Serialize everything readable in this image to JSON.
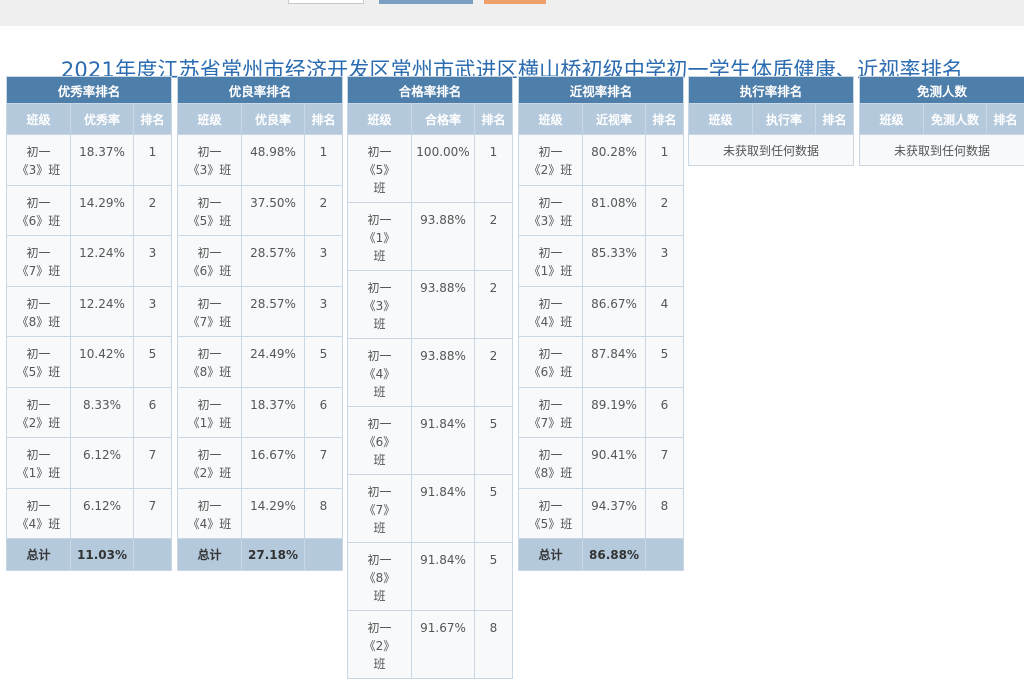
{
  "title": "2021年度江苏省常州市经济开发区常州市武进区横山桥初级中学初一学生体质健康、近视率排名",
  "columns": {
    "class": "班级",
    "rank": "排名"
  },
  "tables": [
    {
      "title": "优秀率排名",
      "value_header": "优秀率",
      "rows": [
        {
          "cls": [
            "初一",
            "《3》班"
          ],
          "value": "18.37%",
          "rank": "1"
        },
        {
          "cls": [
            "初一",
            "《6》班"
          ],
          "value": "14.29%",
          "rank": "2"
        },
        {
          "cls": [
            "初一",
            "《7》班"
          ],
          "value": "12.24%",
          "rank": "3"
        },
        {
          "cls": [
            "初一",
            "《8》班"
          ],
          "value": "12.24%",
          "rank": "3"
        },
        {
          "cls": [
            "初一",
            "《5》班"
          ],
          "value": "10.42%",
          "rank": "5"
        },
        {
          "cls": [
            "初一",
            "《2》班"
          ],
          "value": "8.33%",
          "rank": "6"
        },
        {
          "cls": [
            "初一",
            "《1》班"
          ],
          "value": "6.12%",
          "rank": "7"
        },
        {
          "cls": [
            "初一",
            "《4》班"
          ],
          "value": "6.12%",
          "rank": "7"
        }
      ],
      "total_label": "总计",
      "total_value": "11.03%"
    },
    {
      "title": "优良率排名",
      "value_header": "优良率",
      "rows": [
        {
          "cls": [
            "初一",
            "《3》班"
          ],
          "value": "48.98%",
          "rank": "1"
        },
        {
          "cls": [
            "初一",
            "《5》班"
          ],
          "value": "37.50%",
          "rank": "2"
        },
        {
          "cls": [
            "初一",
            "《6》班"
          ],
          "value": "28.57%",
          "rank": "3"
        },
        {
          "cls": [
            "初一",
            "《7》班"
          ],
          "value": "28.57%",
          "rank": "3"
        },
        {
          "cls": [
            "初一",
            "《8》班"
          ],
          "value": "24.49%",
          "rank": "5"
        },
        {
          "cls": [
            "初一",
            "《1》班"
          ],
          "value": "18.37%",
          "rank": "6"
        },
        {
          "cls": [
            "初一",
            "《2》班"
          ],
          "value": "16.67%",
          "rank": "7"
        },
        {
          "cls": [
            "初一",
            "《4》班"
          ],
          "value": "14.29%",
          "rank": "8"
        }
      ],
      "total_label": "总计",
      "total_value": "27.18%"
    },
    {
      "title": "合格率排名",
      "value_header": "合格率",
      "rows": [
        {
          "cls": [
            "初一",
            "《5》",
            "班"
          ],
          "value": "100.00%",
          "rank": "1"
        },
        {
          "cls": [
            "初一",
            "《1》",
            "班"
          ],
          "value": "93.88%",
          "rank": "2"
        },
        {
          "cls": [
            "初一",
            "《3》",
            "班"
          ],
          "value": "93.88%",
          "rank": "2"
        },
        {
          "cls": [
            "初一",
            "《4》",
            "班"
          ],
          "value": "93.88%",
          "rank": "2"
        },
        {
          "cls": [
            "初一",
            "《6》",
            "班"
          ],
          "value": "91.84%",
          "rank": "5"
        },
        {
          "cls": [
            "初一",
            "《7》",
            "班"
          ],
          "value": "91.84%",
          "rank": "5"
        },
        {
          "cls": [
            "初一",
            "《8》",
            "班"
          ],
          "value": "91.84%",
          "rank": "5"
        },
        {
          "cls": [
            "初一",
            "《2》",
            "班"
          ],
          "value": "91.67%",
          "rank": "8"
        }
      ]
    },
    {
      "title": "近视率排名",
      "value_header": "近视率",
      "rows": [
        {
          "cls": [
            "初一",
            "《2》班"
          ],
          "value": "80.28%",
          "rank": "1"
        },
        {
          "cls": [
            "初一",
            "《3》班"
          ],
          "value": "81.08%",
          "rank": "2"
        },
        {
          "cls": [
            "初一",
            "《1》班"
          ],
          "value": "85.33%",
          "rank": "3"
        },
        {
          "cls": [
            "初一",
            "《4》班"
          ],
          "value": "86.67%",
          "rank": "4"
        },
        {
          "cls": [
            "初一",
            "《6》班"
          ],
          "value": "87.84%",
          "rank": "5"
        },
        {
          "cls": [
            "初一",
            "《7》班"
          ],
          "value": "89.19%",
          "rank": "6"
        },
        {
          "cls": [
            "初一",
            "《8》班"
          ],
          "value": "90.41%",
          "rank": "7"
        },
        {
          "cls": [
            "初一",
            "《5》班"
          ],
          "value": "94.37%",
          "rank": "8"
        }
      ],
      "total_label": "总计",
      "total_value": "86.88%"
    },
    {
      "title": "执行率排名",
      "value_header": "执行率",
      "rows": [],
      "no_data": "未获取到任何数据"
    },
    {
      "title": "免测人数",
      "value_header": "免测人数",
      "rows": [],
      "no_data": "未获取到任何数据"
    }
  ]
}
